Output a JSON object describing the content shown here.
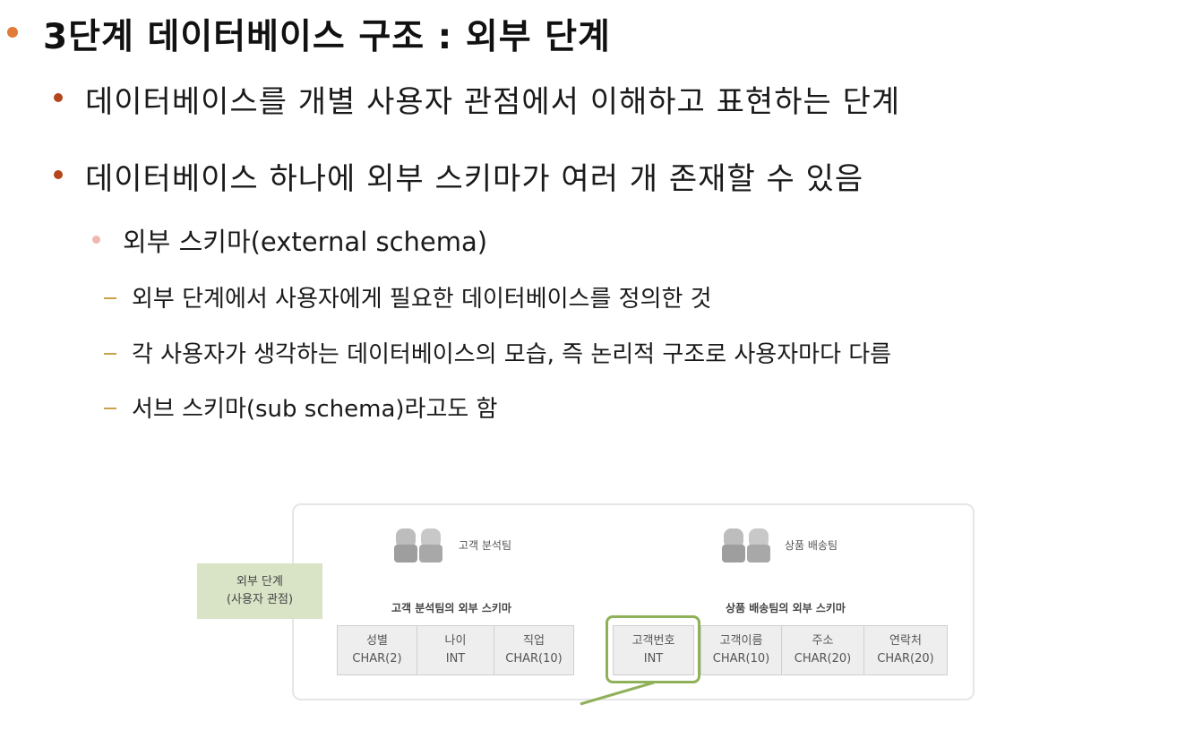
{
  "slide": {
    "title": "3단계 데이터베이스 구조 : 외부 단계",
    "bullets": [
      "데이터베이스를 개별 사용자 관점에서 이해하고 표현하는 단계",
      "데이터베이스 하나에 외부 스키마가 여러 개 존재할 수 있음"
    ],
    "sub_bullet": "외부 스키마(external schema)",
    "dash_items": [
      "외부 단계에서 사용자에게 필요한 데이터베이스를 정의한 것",
      "각 사용자가 생각하는 데이터베이스의 모습, 즉 논리적 구조로 사용자마다 다름",
      "서브 스키마(sub schema)라고도 함"
    ]
  },
  "figure": {
    "stage_label": [
      "외부 단계",
      "(사용자 관점)"
    ],
    "team_left": "고객 분석팀",
    "team_right": "상품 배송팀",
    "schema_left_title": "고객 분석팀의 외부 스키마",
    "schema_right_title": "상품 배송팀의 외부 스키마",
    "left_fields": [
      {
        "name": "성별",
        "type": "CHAR(2)"
      },
      {
        "name": "나이",
        "type": "INT"
      },
      {
        "name": "직업",
        "type": "CHAR(10)"
      }
    ],
    "right_fields": [
      {
        "name": "고객번호",
        "type": "INT"
      },
      {
        "name": "고객이름",
        "type": "CHAR(10)"
      },
      {
        "name": "주소",
        "type": "CHAR(20)"
      },
      {
        "name": "연락처",
        "type": "CHAR(20)"
      }
    ],
    "icons": [
      "people-icon",
      "people-icon"
    ]
  },
  "colors": {
    "title_bullet": "#e07b39",
    "bullet": "#b5451b",
    "sub_bullet": "#f0b8b0",
    "dash": "#c9a24a",
    "stage_label_bg": "#d9e3c6",
    "highlight": "#8fb15a"
  }
}
